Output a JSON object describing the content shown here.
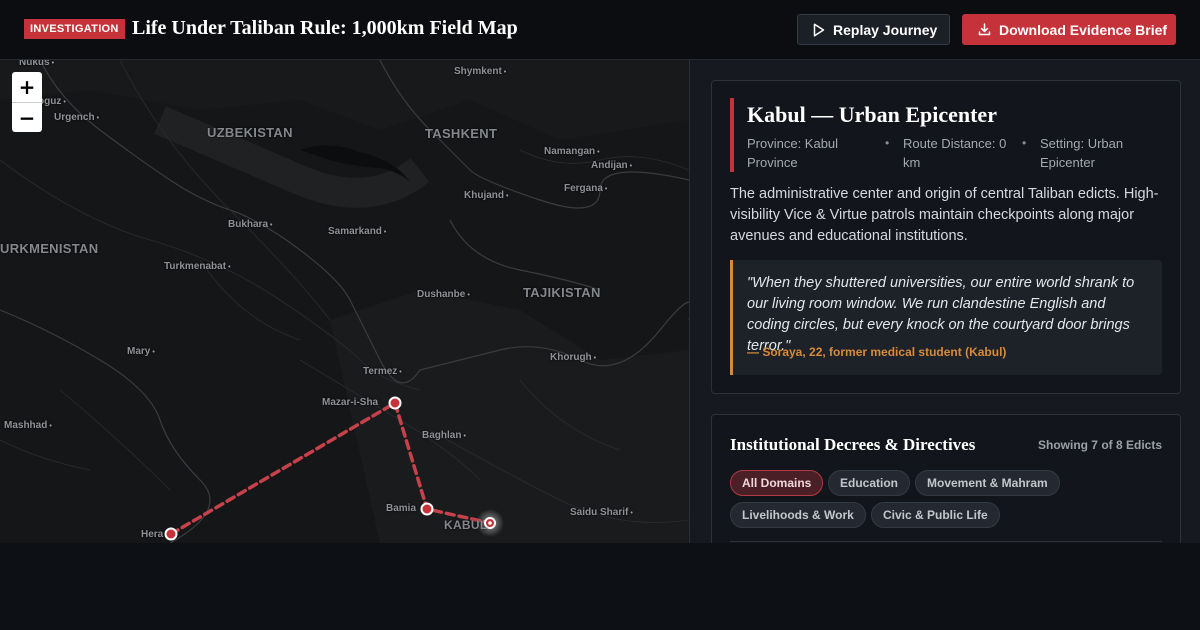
{
  "header": {
    "badge": "INVESTIGATION",
    "title": "Life Under Taliban Rule: 1,000km Field Map",
    "replay_label": "Replay Journey",
    "download_label": "Download Evidence Brief"
  },
  "map": {
    "zoom_in": "+",
    "zoom_out": "−",
    "countries": [
      "UZBEKISTAN",
      "TASHKENT",
      "TAJIKISTAN",
      "URKMENISTAN",
      "KABUL"
    ],
    "cities": [
      "Nukus",
      "Shymkent",
      "oguz",
      "Urgench",
      "Namangan",
      "Andijan",
      "Khujand",
      "Fergana",
      "Bukhara",
      "Samarkand",
      "Turkmenabat",
      "Dushanbe",
      "Mary",
      "Khorugh",
      "Termez",
      "Mazar-i-Sha",
      "Mashhad",
      "Baghlan",
      "Bamia",
      "Saidu Sharif",
      "Hera"
    ]
  },
  "location": {
    "title": "Kabul — Urban Epicenter",
    "province": "Province: Kabul Province",
    "distance": "Route Distance: 0 km",
    "setting": "Setting: Urban Epicenter",
    "separator": "•",
    "description": "The administrative center and origin of central Taliban edicts. High-visibility Vice & Virtue patrols maintain checkpoints along major avenues and educational institutions.",
    "quote": "\"When they shuttered universities, our entire world shrank to our living room window. We run clandestine English and coding circles, but every knock on the courtyard door brings terror.\"",
    "attribution": "— Soraya, 22, former medical student (Kabul)"
  },
  "decrees": {
    "title": "Institutional Decrees & Directives",
    "count": "Showing 7 of 8 Edicts",
    "filters": [
      "All Domains",
      "Education",
      "Movement & Mahram",
      "Livelihoods & Work",
      "Civic & Public Life"
    ]
  },
  "colors": {
    "accent": "#c6323a",
    "quote_accent": "#d88a3a"
  }
}
